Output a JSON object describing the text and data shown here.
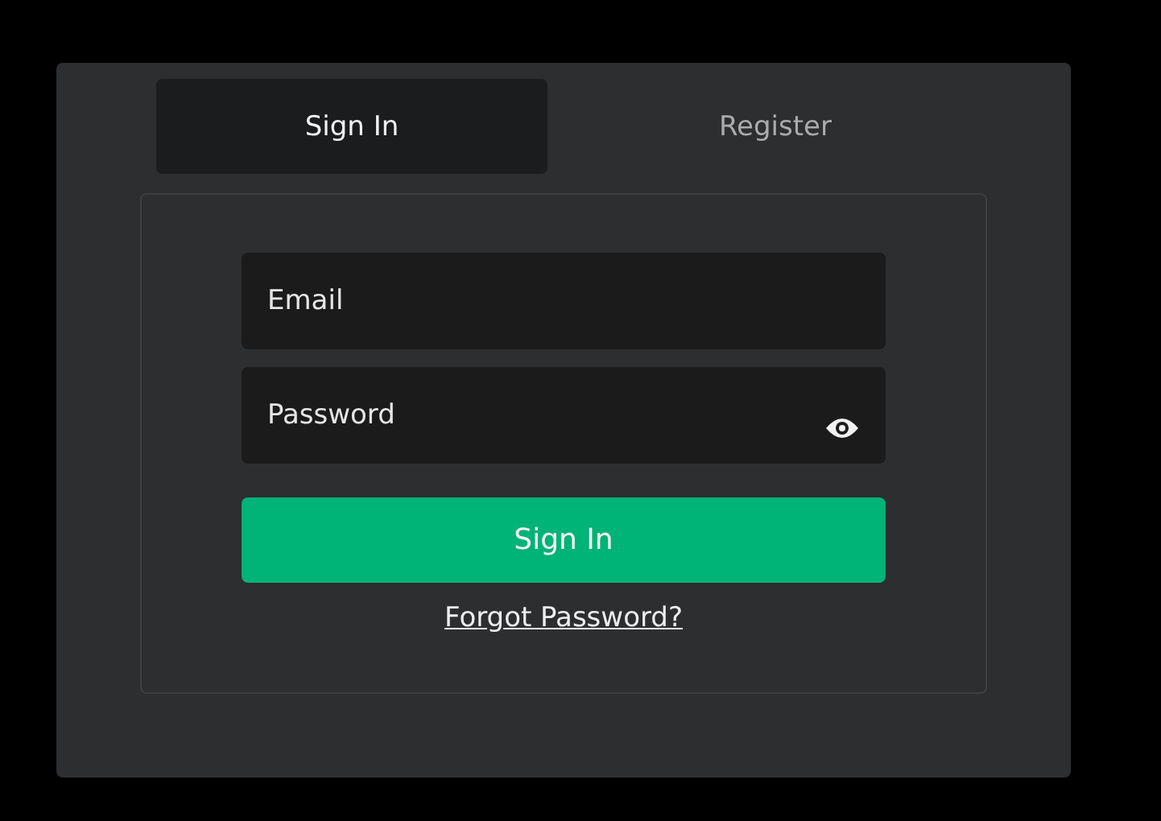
{
  "tabs": [
    {
      "label": "Sign In",
      "selected": true
    },
    {
      "label": "Register",
      "selected": false
    }
  ],
  "form": {
    "email": {
      "placeholder": "Email"
    },
    "password": {
      "placeholder": "Password"
    },
    "submit": "Sign In",
    "forgot_link": "Forgot Password?"
  }
}
